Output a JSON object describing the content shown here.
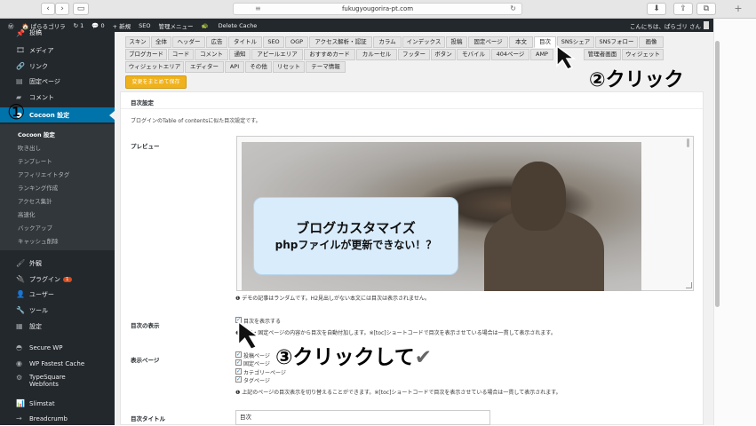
{
  "browser": {
    "url": "fukugyougorira-pt.com",
    "back_icon": "‹",
    "forward_icon": "›",
    "sidebar_icon": "▭",
    "reload_icon": "↻",
    "download_icon": "⬇",
    "share_icon": "⇪",
    "tabs_icon": "⧉",
    "newtab_icon": "+"
  },
  "adminbar": {
    "wp_icon": "Ⓦ",
    "site_name": "🏠 ぱらるゴリラ",
    "updates": "↻ 1",
    "comments": "💬 0",
    "new": "+ 新規",
    "seo": "SEO",
    "manage": "管理メニュー",
    "delete_cache": "Delete Cache",
    "greeting": "こんにちは、ぱらゴリ さん"
  },
  "sidebar": {
    "menu_top": "投稿",
    "media": "メディア",
    "links": "リンク",
    "pages": "固定ページ",
    "comments": "コメント",
    "cocoon": "Cocoon 設定",
    "submenu": [
      "Cocoon 設定",
      "吹き出し",
      "テンプレート",
      "アフィリエイトタグ",
      "ランキング作成",
      "アクセス集計",
      "高速化",
      "バックアップ",
      "キャッシュ削除"
    ],
    "appearance": "外観",
    "plugins": "プラグイン",
    "plugins_badge": "1",
    "users": "ユーザー",
    "tools": "ツール",
    "settings": "設定",
    "secure_wp": "Secure WP",
    "wp_fastest_cache": "WP Fastest Cache",
    "typesquare_1": "TypeSquare",
    "typesquare_2": "Webfonts",
    "slimstat": "Slimstat",
    "breadcrumb": "Breadcrumb"
  },
  "tabs": {
    "row1": [
      "スキン",
      "全体",
      "ヘッダー",
      "広告",
      "タイトル",
      "SEO",
      "OGP",
      "アクセス解析・認証",
      "カラム",
      "インデックス",
      "投稿",
      "固定ページ",
      "本文",
      "目次",
      "SNSシェア",
      "SNSフォロー",
      "画像"
    ],
    "row2": [
      "ブログカード",
      "コード",
      "コメント",
      "通知",
      "アピールエリア",
      "おすすめカード",
      "カルーセル",
      "フッター",
      "ボタン",
      "モバイル",
      "404ページ",
      "AMP",
      "管理者画面",
      "ウィジェット"
    ],
    "row3": [
      "ウィジェットエリア",
      "エディター",
      "API",
      "その他",
      "リセット",
      "テーマ情報"
    ],
    "active": "目次"
  },
  "save_button": "変更をまとめて保存",
  "panel": {
    "title": "目次設定",
    "description": "ブログインのTable of contentsに似た目次設定です。",
    "preview_label": "プレビュー",
    "preview_caption_l1": "ブログカスタマイズ",
    "preview_caption_l2": "phpファイルが更新できない！？",
    "preview_note": "❶ デモの記事はランダムです。H2見出しがない本文には目次は表示されません。",
    "display_label": "目次の表示",
    "display_checkbox": "目次を表示する",
    "display_note": "❶ 投稿・固定ページの内容から目次を自動付加します。※[toc]ショートコードで目次を表示させている場合は一貫して表示されます。",
    "display_pages_label": "表示ページ",
    "pages_options": [
      "投稿ページ",
      "固定ページ",
      "カテゴリーページ",
      "タグページ"
    ],
    "pages_note": "❶ 上記のページの目次表示を切り替えることができます。※[toc]ショートコードで目次を表示させている場合は一貫して表示されます。",
    "toc_title_label": "目次タイトル",
    "toc_title_value": "目次"
  },
  "annotations": {
    "marker_1": "①",
    "marker_2": "②クリック",
    "marker_3": "③クリックして",
    "marker_3_check": "✔"
  }
}
